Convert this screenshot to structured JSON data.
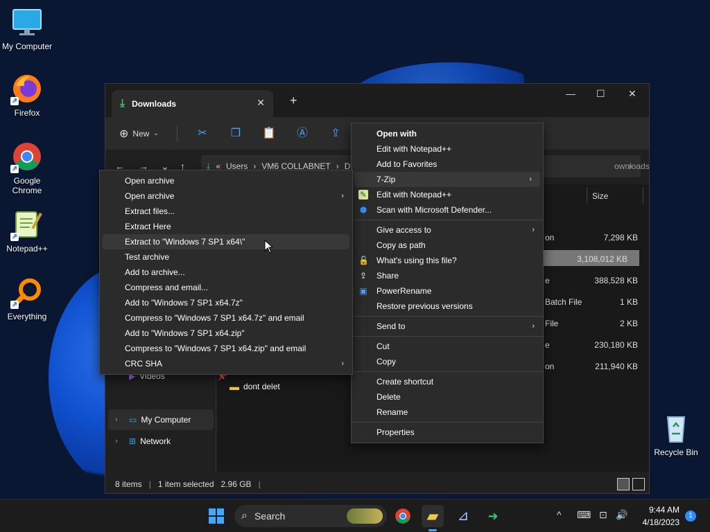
{
  "desktop": {
    "icons": [
      {
        "label": "My Computer",
        "icon": "monitor-icon"
      },
      {
        "label": "Firefox",
        "icon": "firefox-icon"
      },
      {
        "label": "Google Chrome",
        "icon": "chrome-icon"
      },
      {
        "label": "Notepad++",
        "icon": "notepadpp-icon"
      },
      {
        "label": "Everything",
        "icon": "everything-icon"
      },
      {
        "label": "Recycle Bin",
        "icon": "recycle-bin-icon"
      }
    ]
  },
  "explorer": {
    "tab_title": "Downloads",
    "toolbar": {
      "new_label": "New"
    },
    "address": {
      "parts": [
        "«",
        "Users",
        "›",
        "VM6 COLLABNET",
        "›",
        "D"
      ]
    },
    "search_placeholder": "Search Downloads",
    "search_visible": "ownloads",
    "nav": {
      "videos": "Videos",
      "my_computer": "My Computer",
      "network": "Network"
    },
    "columns": {
      "size": "Size"
    },
    "folder": "dont delet",
    "rows": [
      {
        "type": "on",
        "size": "7,298 KB"
      },
      {
        "type": "",
        "size": "3,108,012 KB"
      },
      {
        "type": "e",
        "size": "388,528 KB"
      },
      {
        "type": "Batch File",
        "size": "1 KB"
      },
      {
        "type": "File",
        "size": "2 KB"
      },
      {
        "type": "e",
        "size": "230,180 KB"
      },
      {
        "type": "on",
        "size": "211,940 KB"
      }
    ],
    "status": {
      "items": "8 items",
      "selected": "1 item selected",
      "size": "2.96 GB"
    }
  },
  "context_menu": {
    "items": [
      {
        "label": "Open with",
        "bold": true
      },
      {
        "label": "Edit with Notepad++"
      },
      {
        "label": "Add to Favorites"
      },
      {
        "label": "7-Zip",
        "submenu": true
      },
      {
        "label": "Edit with Notepad++",
        "icon": "notepadpp-icon"
      },
      {
        "label": "Scan with Microsoft Defender...",
        "icon": "defender-shield-icon"
      },
      {
        "sep": true
      },
      {
        "label": "Give access to",
        "submenu": true
      },
      {
        "label": "Copy as path"
      },
      {
        "label": "What's using this file?",
        "icon": "lock-icon"
      },
      {
        "label": "Share",
        "icon": "share-icon"
      },
      {
        "label": "PowerRename",
        "icon": "powerrename-icon"
      },
      {
        "label": "Restore previous versions"
      },
      {
        "sep": true
      },
      {
        "label": "Send to",
        "submenu": true
      },
      {
        "sep": true
      },
      {
        "label": "Cut"
      },
      {
        "label": "Copy"
      },
      {
        "sep": true
      },
      {
        "label": "Create shortcut"
      },
      {
        "label": "Delete"
      },
      {
        "label": "Rename"
      },
      {
        "sep": true
      },
      {
        "label": "Properties"
      }
    ]
  },
  "zip_menu": {
    "items": [
      {
        "label": "Open archive"
      },
      {
        "label": "Open archive",
        "submenu": true
      },
      {
        "label": "Extract files..."
      },
      {
        "label": "Extract Here"
      },
      {
        "label": "Extract to \"Windows 7 SP1 x64\\\"",
        "hover": true
      },
      {
        "label": "Test archive"
      },
      {
        "label": "Add to archive..."
      },
      {
        "label": "Compress and email..."
      },
      {
        "label": "Add to \"Windows 7 SP1 x64.7z\""
      },
      {
        "label": "Compress to \"Windows 7 SP1 x64.7z\" and email"
      },
      {
        "label": "Add to \"Windows 7 SP1 x64.zip\""
      },
      {
        "label": "Compress to \"Windows 7 SP1 x64.zip\" and email"
      },
      {
        "label": "CRC SHA",
        "submenu": true
      }
    ]
  },
  "taskbar": {
    "search_label": "Search",
    "time": "9:44 AM",
    "date": "4/18/2023",
    "notifications": "1"
  }
}
